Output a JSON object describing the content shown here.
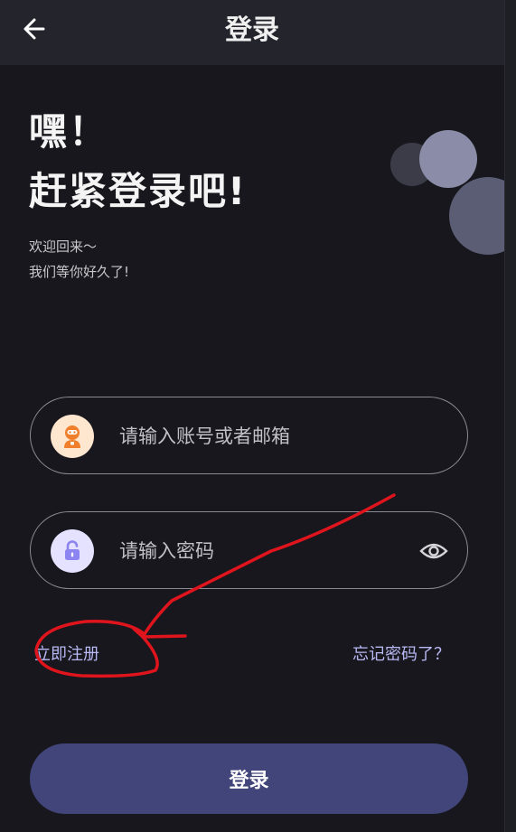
{
  "header": {
    "title": "登录",
    "back_icon": "arrow-left-icon"
  },
  "greeting": {
    "line1": "嘿！",
    "line2": "赶紧登录吧!",
    "sub1": "欢迎回来～",
    "sub2": "我们等你好久了!"
  },
  "form": {
    "account": {
      "placeholder": "请输入账号或者邮箱",
      "value": "",
      "icon": "user-avatar-icon"
    },
    "password": {
      "placeholder": "请输入密码",
      "value": "",
      "icon": "unlock-icon",
      "toggle_icon": "eye-icon"
    }
  },
  "links": {
    "register": "立即注册",
    "forgot": "忘记密码了？"
  },
  "actions": {
    "login": "登录"
  },
  "colors": {
    "background": "#17171d",
    "header": "#24242c",
    "accent": "#41457a",
    "link": "#b9b9f5",
    "annotation": "#e0141c"
  }
}
